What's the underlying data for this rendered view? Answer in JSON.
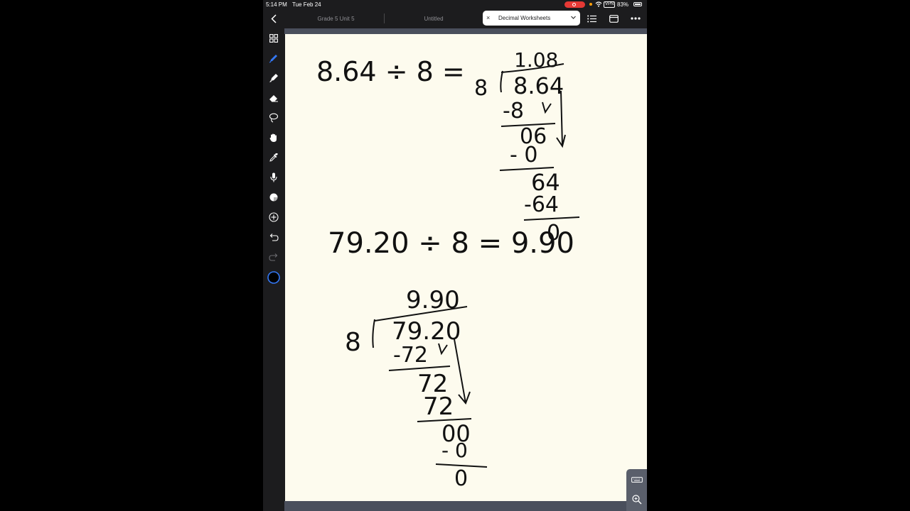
{
  "status": {
    "time": "5:14 PM",
    "date": "Tue Feb 24",
    "vpn": "VPN",
    "battery": "83%"
  },
  "tabs": [
    {
      "label": "Grade 5 Unit 5",
      "active": false
    },
    {
      "label": "Untitled",
      "active": false
    },
    {
      "label": "Decimal Worksheets",
      "active": true
    }
  ],
  "toolbar": {
    "close": "×"
  },
  "sidebar_tools": [
    "grid-icon",
    "pen-icon",
    "highlighter-icon",
    "eraser-icon",
    "lasso-icon",
    "hand-icon",
    "eyedropper-icon",
    "microphone-icon",
    "shapes-icon",
    "add-icon",
    "undo-icon",
    "redo-icon",
    "color-icon"
  ],
  "colors": {
    "accent": "#3478f6",
    "paper": "#fdfbee",
    "chrome": "#1c1c1e",
    "record": "#e53935"
  },
  "handwriting": {
    "problem1": "8.64 ÷ 8 =",
    "p1_quotient": "1.08",
    "p1_divisor": "8",
    "p1_dividend": "8.64",
    "p1_sub1": "-8",
    "p1_rem1": "06",
    "p1_sub2": "- 0",
    "p1_rem2": "64",
    "p1_sub3": "-64",
    "p1_final": "0",
    "problem2": "79.20 ÷ 8 = 9.90",
    "p2_quotient": "9.90",
    "p2_divisor": "8",
    "p2_dividend": "79.20",
    "p2_sub1": "-72",
    "p2_rem1": "72",
    "p2_sub2": "72",
    "p2_rem2": "00",
    "p2_sub3": "- 0",
    "p2_final": "0"
  }
}
